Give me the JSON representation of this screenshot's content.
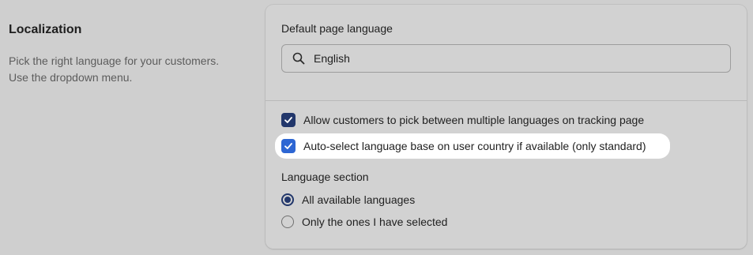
{
  "section": {
    "title": "Localization",
    "description_line1": "Pick the right language for your customers.",
    "description_line2": "Use the dropdown menu."
  },
  "language_field": {
    "label": "Default page language",
    "value": "English",
    "icon": "search-icon"
  },
  "options": [
    {
      "label": "Allow customers to pick between multiple languages on tracking page",
      "checked": true
    },
    {
      "label": "Auto-select language base on user country if available (only standard)",
      "checked": true,
      "highlighted": true
    }
  ],
  "language_section": {
    "label": "Language section",
    "choices": [
      {
        "label": "All available languages",
        "selected": true
      },
      {
        "label": "Only the ones I have selected",
        "selected": false
      }
    ]
  },
  "colors": {
    "checkbox_dim": "#22376b",
    "checkbox_highlighted": "#2d66d3",
    "overlay": "#cfcfcf",
    "highlight": "#ffffff"
  }
}
